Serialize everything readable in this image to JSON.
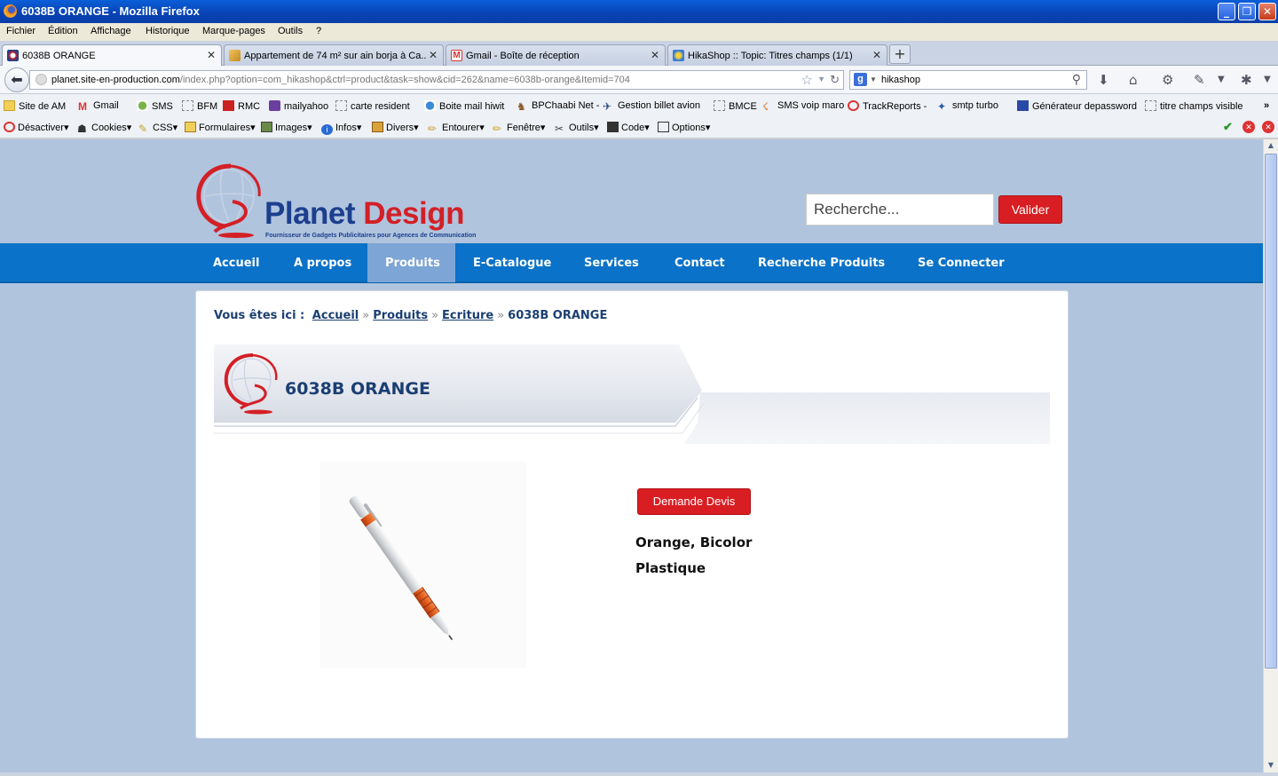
{
  "window": {
    "title": "6038B ORANGE - Mozilla Firefox"
  },
  "menu": [
    "Fichier",
    "Édition",
    "Affichage",
    "Historique",
    "Marque-pages",
    "Outils",
    "?"
  ],
  "tabs": [
    {
      "label": "6038B ORANGE",
      "active": true
    },
    {
      "label": "Appartement de 74 m² sur ain borja à Ca..."
    },
    {
      "label": "Gmail - Boîte de réception"
    },
    {
      "label": "HikaShop :: Topic: Titres champs (1/1)"
    }
  ],
  "url": {
    "host": "planet.site-en-production.com",
    "path": "/index.php?option=com_hikashop&ctrl=product&task=show&cid=262&name=6038b-orange&Itemid=704"
  },
  "browser_search": {
    "value": "hikashop"
  },
  "bookmarks": [
    "Site de AM",
    "Gmail",
    "SMS",
    "BFM",
    "RMC",
    "mailyahoo",
    "carte resident",
    "Boite mail hiwit",
    "BPChaabi Net -",
    "Gestion billet avion",
    "BMCE",
    "SMS voip maro",
    "TrackReports -",
    "smtp turbo",
    "Générateur depassword",
    "titre champs visible"
  ],
  "webdev": [
    "Désactiver",
    "Cookies",
    "CSS",
    "Formulaires",
    "Images",
    "Infos",
    "Divers",
    "Entourer",
    "Fenêtre",
    "Outils",
    "Code",
    "Options"
  ],
  "site": {
    "logo_part1": "Planet ",
    "logo_part2": "Design",
    "tagline": "Fournisseur de Gadgets Publicitaires pour Agences de Communication",
    "search_placeholder": "Recherche...",
    "search_button": "Valider",
    "nav": [
      "Accueil",
      "A propos",
      "Produits",
      "E-Catalogue",
      "Services",
      "Contact",
      "Recherche Produits",
      "Se Connecter"
    ],
    "nav_active": "Produits",
    "colors": {
      "nav": "#0a72c8",
      "accent": "#d81e22",
      "page_bg": "#b0c4de",
      "title": "#1b3f72"
    }
  },
  "breadcrumb": {
    "prefix": "Vous êtes ici :",
    "items": [
      "Accueil",
      "Produits",
      "Ecriture"
    ],
    "current": "6038B ORANGE"
  },
  "product": {
    "title": "6038B ORANGE",
    "quote_button": "Demande Devis",
    "attributes": [
      "Orange, Bicolor",
      "Plastique"
    ]
  }
}
